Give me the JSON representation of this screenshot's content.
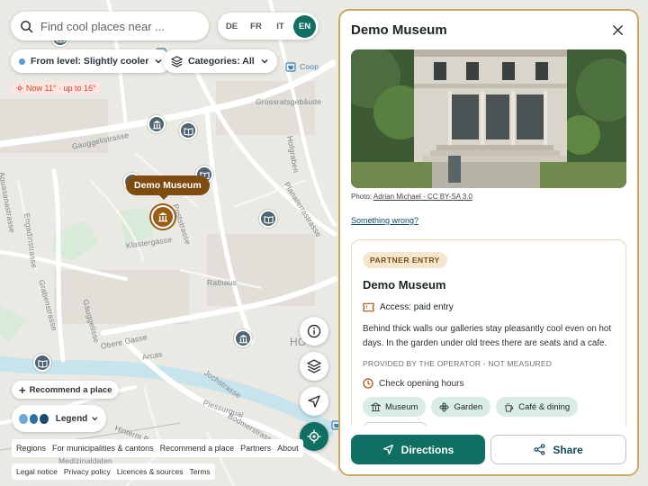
{
  "search": {
    "placeholder": "Find cool places near ..."
  },
  "languages": [
    {
      "code": "DE",
      "active": false
    },
    {
      "code": "FR",
      "active": false
    },
    {
      "code": "IT",
      "active": false
    },
    {
      "code": "EN",
      "active": true
    }
  ],
  "filters": {
    "level_label": "From level: Slightly cooler",
    "categories_label": "Categories: All"
  },
  "weather": {
    "text": "Now 11° · up to 16°"
  },
  "map": {
    "streets": [
      "Gauggelistrasse",
      "Grossratsgebäude",
      "Hofgraben",
      "Planaterrastrasse",
      "Engadinstrasse",
      "Aquasanastrasse",
      "Poststrasse",
      "Klostergasse",
      "Rathaus",
      "Grabenstrasse",
      "Gäuggelisse",
      "Obere Gasse",
      "Arcas",
      "Jochstrasse",
      "Plessurquai",
      "Bodmerstrasse",
      "Hinterm Bach",
      "Medizinaldaten",
      "Coop",
      "HO"
    ],
    "selected_marker": "Demo Museum"
  },
  "buttons": {
    "recommend": "Recommend a place",
    "legend": "Legend"
  },
  "legend_colors": [
    "#6fa8d8",
    "#2f6fa8",
    "#1b4a73"
  ],
  "footer": {
    "links": [
      "Regions",
      "For municipalities & cantons",
      "Recommend a place",
      "Partners",
      "About"
    ],
    "legal": [
      "Legal notice",
      "Privacy policy",
      "Licences & sources",
      "Terms"
    ]
  },
  "panel": {
    "title": "Demo Museum",
    "photo_credit_prefix": "Photo:",
    "photo_credit_link": "Adrian Michael - CC BY-SA 3.0",
    "something_wrong": "Something wrong?",
    "card": {
      "badge": "PARTNER ENTRY",
      "title": "Demo Museum",
      "access": "Access: paid entry",
      "description": "Behind thick walls our galleries stay pleasantly cool even on hot days. In the garden under old trees there are seats and a cafe.",
      "provided": "PROVIDED BY THE OPERATOR - NOT MEASURED",
      "hours": "Check opening hours",
      "tags": [
        "Museum",
        "Garden",
        "Café & dining"
      ]
    },
    "actions": {
      "directions": "Directions",
      "share": "Share"
    }
  },
  "colors": {
    "accent": "#0f6f62",
    "marker": "#9a5d16",
    "panel_border": "#c9a868",
    "poi": "#4e6470"
  }
}
